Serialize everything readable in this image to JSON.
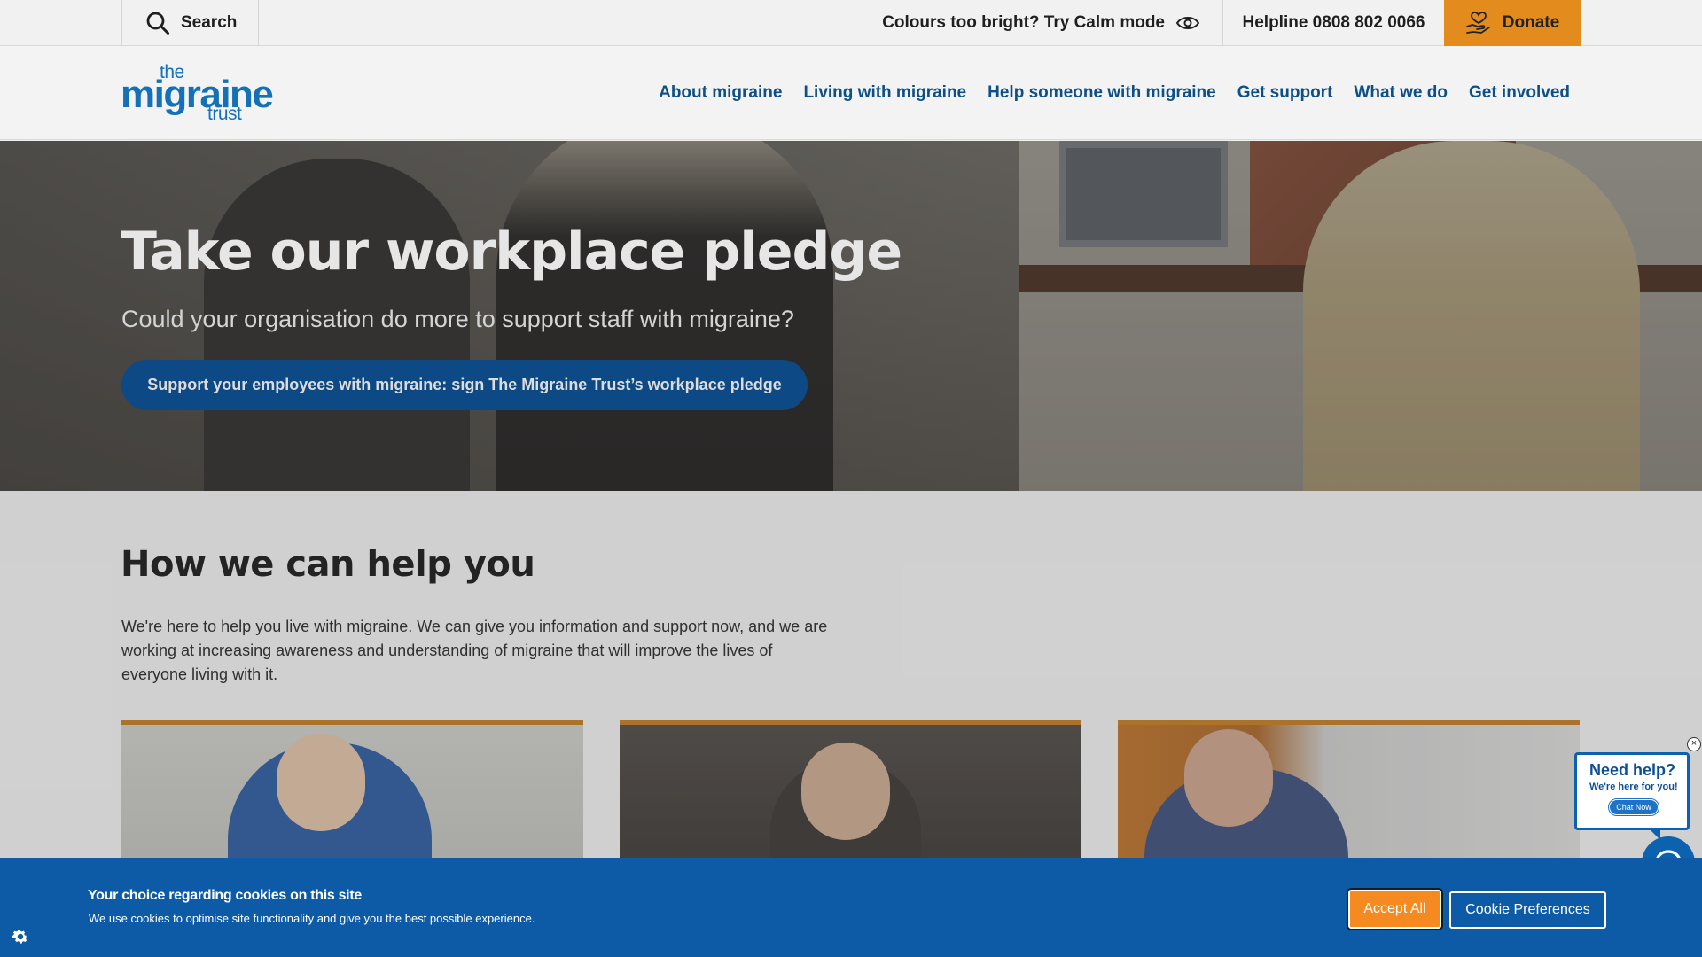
{
  "topbar": {
    "search_label": "Search",
    "calm_label": "Colours too bright? Try Calm mode",
    "helpline": "Helpline 0808 802 0066",
    "donate_label": "Donate"
  },
  "logo": {
    "line1": "the",
    "line2": "migraine",
    "line3": "trust"
  },
  "nav": [
    "About migraine",
    "Living with migraine",
    "Help someone with migraine",
    "Get support",
    "What we do",
    "Get involved"
  ],
  "hero": {
    "title": "Take our workplace pledge",
    "subtitle": "Could your organisation do more to support staff with migraine?",
    "cta": "Support your employees with migraine: sign The Migraine Trust’s workplace pledge"
  },
  "help": {
    "title": "How we can help you",
    "body": "We're here to help you live with migraine. We can give you information and support now, and we are working at increasing awareness and understanding of migraine that will improve the lives of everyone living with it."
  },
  "chat": {
    "heading": "Need help?",
    "subheading": "We're here for you!",
    "button": "Chat Now",
    "close": "×"
  },
  "cookie": {
    "title": "Your choice regarding cookies on this site",
    "text": "We use cookies to optimise site functionality and give you the best possible experience.",
    "accept": "Accept All",
    "preferences": "Cookie Preferences"
  },
  "colors": {
    "brand_blue": "#1471b8",
    "nav_blue": "#0d4f86",
    "donate_orange": "#e38b1d",
    "cookie_blue": "#0d5ba6",
    "accept_orange": "#f58a20"
  },
  "icons": [
    "search-icon",
    "eye-icon",
    "donate-heart-hand-icon",
    "chat-icon",
    "cookie-gear-icon"
  ]
}
